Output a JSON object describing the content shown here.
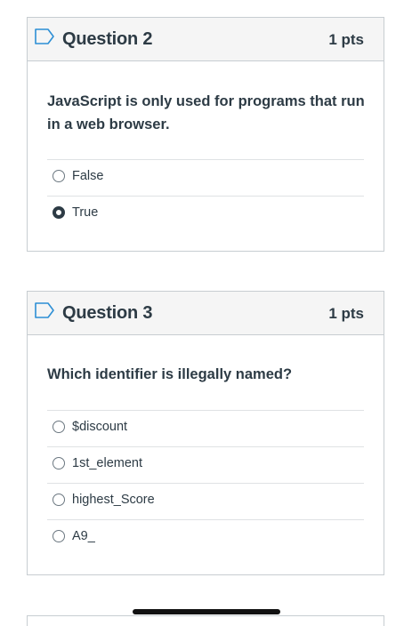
{
  "questions": [
    {
      "title": "Question 2",
      "points": "1 pts",
      "text": "JavaScript is only used for programs that run in a web browser.",
      "answers": [
        {
          "label": "False",
          "selected": false
        },
        {
          "label": "True",
          "selected": true
        }
      ]
    },
    {
      "title": "Question 3",
      "points": "1 pts",
      "text": "Which identifier is illegally named?",
      "answers": [
        {
          "label": "$discount",
          "selected": false
        },
        {
          "label": "1st_element",
          "selected": false
        },
        {
          "label": "highest_Score",
          "selected": false
        },
        {
          "label": "A9_",
          "selected": false
        }
      ]
    }
  ],
  "colors": {
    "text": "#2d3b45",
    "header_bg": "#f5f5f5",
    "border": "#c7cdd1",
    "flag": "#2d8fd5"
  },
  "icons": {
    "flag": "bookmark-flag-icon",
    "radio_unchecked": "radio-unchecked",
    "radio_checked": "radio-checked"
  }
}
